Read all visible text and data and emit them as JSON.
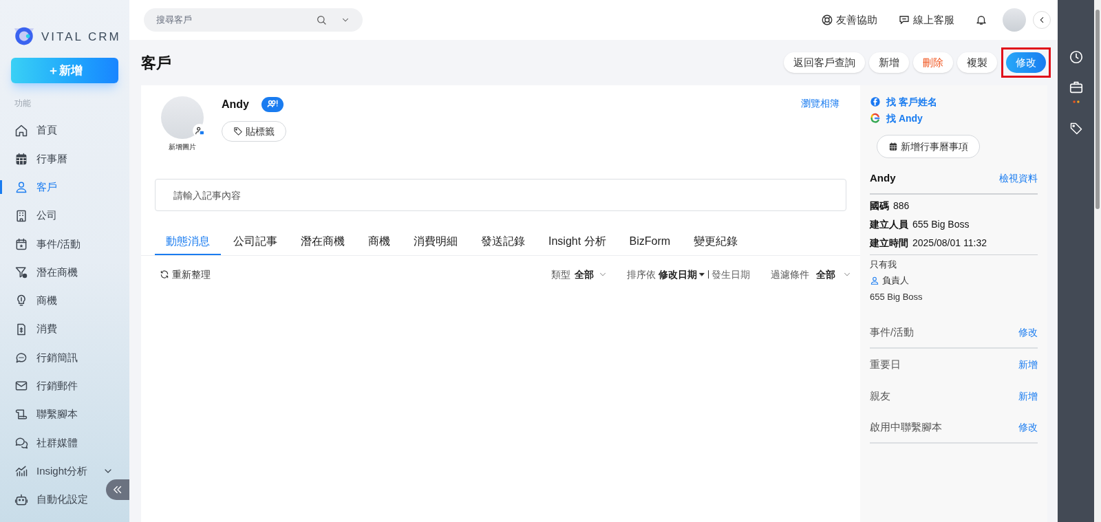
{
  "brand": {
    "name": "VITAL CRM"
  },
  "sidebar": {
    "new_button": "＋新增",
    "section_label": "功能",
    "items": [
      {
        "label": "首頁",
        "selected": false
      },
      {
        "label": "行事曆",
        "selected": false
      },
      {
        "label": "客戶",
        "selected": true
      },
      {
        "label": "公司",
        "selected": false
      },
      {
        "label": "事件/活動",
        "selected": false
      },
      {
        "label": "潛在商機",
        "selected": false
      },
      {
        "label": "商機",
        "selected": false
      },
      {
        "label": "消費",
        "selected": false
      },
      {
        "label": "行銷簡訊",
        "selected": false
      },
      {
        "label": "行銷郵件",
        "selected": false
      },
      {
        "label": "聯繫腳本",
        "selected": false
      },
      {
        "label": "社群媒體",
        "selected": false
      },
      {
        "label": "Insight分析",
        "selected": false,
        "expanded": false
      },
      {
        "label": "自動化設定",
        "selected": false
      }
    ]
  },
  "search": {
    "placeholder": "搜尋客戶"
  },
  "top_links": [
    "友善協助",
    "線上客服"
  ],
  "page_title": "客戶",
  "actions": [
    {
      "label": "返回客戶查詢",
      "kind": "normal",
      "highlighted": false
    },
    {
      "label": "新增",
      "kind": "normal",
      "highlighted": false
    },
    {
      "label": "刪除",
      "kind": "danger",
      "highlighted": false
    },
    {
      "label": "複製",
      "kind": "normal",
      "highlighted": false
    },
    {
      "label": "修改",
      "kind": "primary",
      "highlighted": true
    }
  ],
  "profile": {
    "avatar_caption": "新增圖片",
    "name": "Andy",
    "tag_button": "貼標籤",
    "album_link": "瀏覽相簿"
  },
  "note_field": {
    "placeholder": "請輸入記事內容"
  },
  "tabs": [
    {
      "label": "動態消息",
      "selected": true
    },
    {
      "label": "公司記事",
      "selected": false
    },
    {
      "label": "潛在商機",
      "selected": false
    },
    {
      "label": "商機",
      "selected": false
    },
    {
      "label": "消費明細",
      "selected": false
    },
    {
      "label": "發送記錄",
      "selected": false
    },
    {
      "label": "Insight 分析",
      "selected": false
    },
    {
      "label": "BizForm",
      "selected": false
    },
    {
      "label": "變更紀錄",
      "selected": false
    }
  ],
  "toolbar": {
    "refresh": "重新整理",
    "type_label": "類型",
    "type_value": "全部",
    "sort_label": "排序依",
    "sort_options": [
      {
        "label": "修改日期",
        "selected": true
      },
      {
        "label": "發生日期",
        "selected": false
      }
    ],
    "filter_label": "過濾條件",
    "filter_value": "全部"
  },
  "side_panel": {
    "search_links": [
      {
        "kind": "facebook",
        "label": "找 客戶姓名"
      },
      {
        "kind": "google",
        "label": "找 Andy"
      }
    ],
    "calendar_button": "新增行事曆事項",
    "name": "Andy",
    "view_link": "檢視資料",
    "fields": [
      {
        "label": "國碼",
        "value": "886"
      },
      {
        "label": "建立人員",
        "value": "655 Big Boss"
      },
      {
        "label": "建立時間",
        "value": "2025/08/01 11:32"
      }
    ],
    "visibility": "只有我",
    "owner_label": "負責人",
    "owner": "655 Big Boss",
    "sections": [
      {
        "label": "事件/活動",
        "action": "修改",
        "divider": true
      },
      {
        "label": "重要日",
        "action": "新增",
        "divider": false
      },
      {
        "label": "親友",
        "action": "新增",
        "divider": false
      },
      {
        "label": "啟用中聯繫腳本",
        "action": "修改",
        "divider": true
      }
    ]
  }
}
